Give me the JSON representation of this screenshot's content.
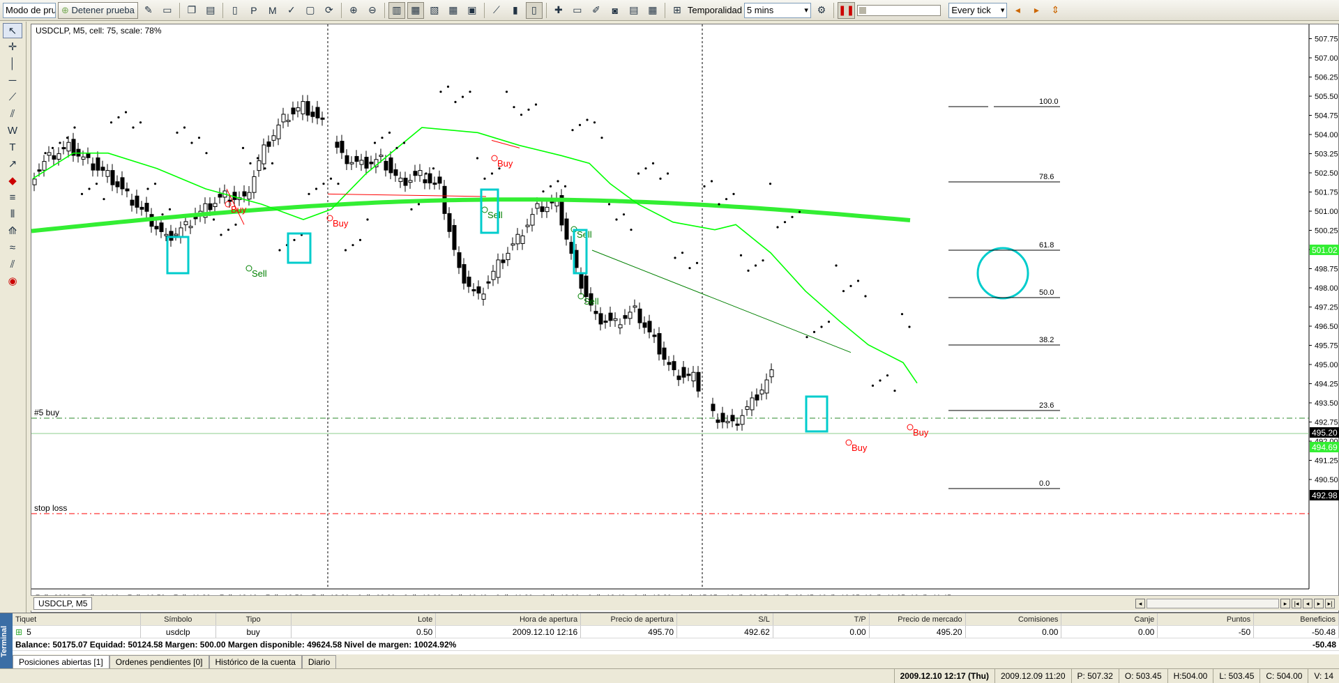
{
  "toolbar": {
    "mode_select": "Modo de pru",
    "stop_button": "Detener prueba",
    "timeframe_label": "Temporalidad",
    "timeframe_value": "5 mins",
    "tick_mode": "Every tick"
  },
  "chart": {
    "info": "USDCLP, M5, cell: 75, scale: 78%",
    "tab": "USDCLP, M5",
    "price_levels": [
      "507.75",
      "507.00",
      "506.25",
      "505.50",
      "504.75",
      "504.00",
      "503.25",
      "502.50",
      "501.75",
      "501.00",
      "500.25",
      "499.50",
      "498.75",
      "498.00",
      "497.25",
      "496.50",
      "495.75",
      "495.00",
      "494.25",
      "493.50",
      "492.75",
      "492.00",
      "491.25",
      "490.50"
    ],
    "time_labels": [
      "7 dic 2009",
      "7 dic 10:10",
      "7 dic 10:50",
      "7 dic 11:30",
      "7 dic 12:10",
      "7 dic 12:50",
      "7 dic 13:30",
      "9 dic 09:20",
      "9 dic 10:00",
      "9 dic 10:40",
      "9 dic 11:20",
      "9 dic 12:00",
      "9 dic 12:40",
      "9 dic 13:20",
      "9 dic 15:05",
      "10 dic 09:05",
      "10 dic 09:45",
      "10 dic 10:25",
      "10 dic 11:05",
      "10 dic 11:45"
    ],
    "badges": {
      "ma_price": "501.02",
      "bid": "495.20",
      "ask": "494.69",
      "stop": "492.98"
    },
    "line_labels": {
      "buy_line": "#5 buy",
      "stop_line": "stop loss"
    },
    "fib_levels": [
      "100.0",
      "78.6",
      "61.8",
      "50.0",
      "38.2",
      "23.6",
      "0.0"
    ],
    "signals": {
      "buy": "Buy",
      "sell": "Sell"
    },
    "colors": {
      "ma_fast": "#00ff00",
      "ma_slow": "#33ee33",
      "marker": "#00cccc",
      "buy": "#ff0000",
      "sell": "#008000",
      "sar": "#000000"
    }
  },
  "terminal": {
    "side_label": "Terminal",
    "headers": [
      "Tiquet",
      "Símbolo",
      "Tipo",
      "Lote",
      "Hora de apertura",
      "Precio de apertura",
      "S/L",
      "T/P",
      "Precio de mercado",
      "Comisiones",
      "Canje",
      "Puntos",
      "Beneficios"
    ],
    "row": {
      "ticket": "5",
      "symbol": "usdclp",
      "type": "buy",
      "lot": "0.50",
      "open_time": "2009.12.10 12:16",
      "open_price": "495.70",
      "sl": "492.62",
      "tp": "0.00",
      "market_price": "495.20",
      "commission": "0.00",
      "swap": "0.00",
      "points": "-50",
      "profit": "-50.48"
    },
    "balance_line": "Balance: 50175.07 Equidad: 50124.58 Margen: 500.00 Margen disponible: 49624.58 Nivel de margen: 10024.92%",
    "balance_profit": "-50.48",
    "tabs": [
      "Posiciones abiertas [1]",
      "Ordenes pendientes [0]",
      "Histórico de la cuenta",
      "Diario"
    ]
  },
  "status": {
    "datetime": "2009.12.10 12:17 (Thu)",
    "bar_time": "2009.12.09 11:20",
    "open": "P: 507.32",
    "o": "O: 503.45",
    "h": "H:504.00",
    "l": "L: 503.45",
    "c": "C: 504.00",
    "v": "V: 14"
  }
}
